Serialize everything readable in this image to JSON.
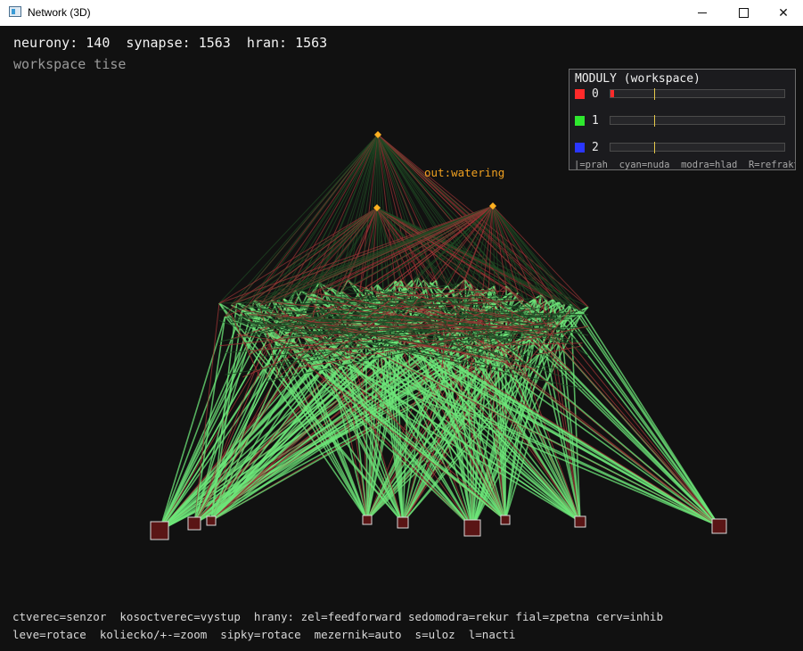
{
  "window": {
    "title": "Network (3D)",
    "minimize_icon": "minimize-icon",
    "maximize_icon": "maximize-icon",
    "close_icon": "close-icon",
    "close_glyph": "✕"
  },
  "hud": {
    "stats": "neurony: 140  synapse: 1563  hran: 1563",
    "state": "workspace tise"
  },
  "modules_panel": {
    "title": "MODULY (workspace)",
    "modules": [
      {
        "id": "0",
        "color": "#ff2a2a",
        "activation": 0.02,
        "threshold": 0.25
      },
      {
        "id": "1",
        "color": "#2ee82e",
        "activation": 0.0,
        "threshold": 0.25
      },
      {
        "id": "2",
        "color": "#2a36ff",
        "activation": 0.0,
        "threshold": 0.25
      }
    ],
    "footer": "|=prah  cyan=nuda  modra=hlad  R=refrakt"
  },
  "graph": {
    "output_label": "out:watering",
    "colors": {
      "feedforward": "#6ee77a",
      "inhibitory": "#9a3434",
      "dark_edge": "#1f4a24",
      "sensor_fill": "#5a1515",
      "sensor_border": "#d9d9d9",
      "output_node": "#ffb020"
    }
  },
  "legend": {
    "line1": "ctverec=senzor  kosoctverec=vystup  hrany: zel=feedforward sedomodra=rekur fial=zpetna cerv=inhib",
    "line2": "leve=rotace  koliecko/+-=zoom  sipky=rotace  mezernik=auto  s=uloz  l=nacti"
  }
}
